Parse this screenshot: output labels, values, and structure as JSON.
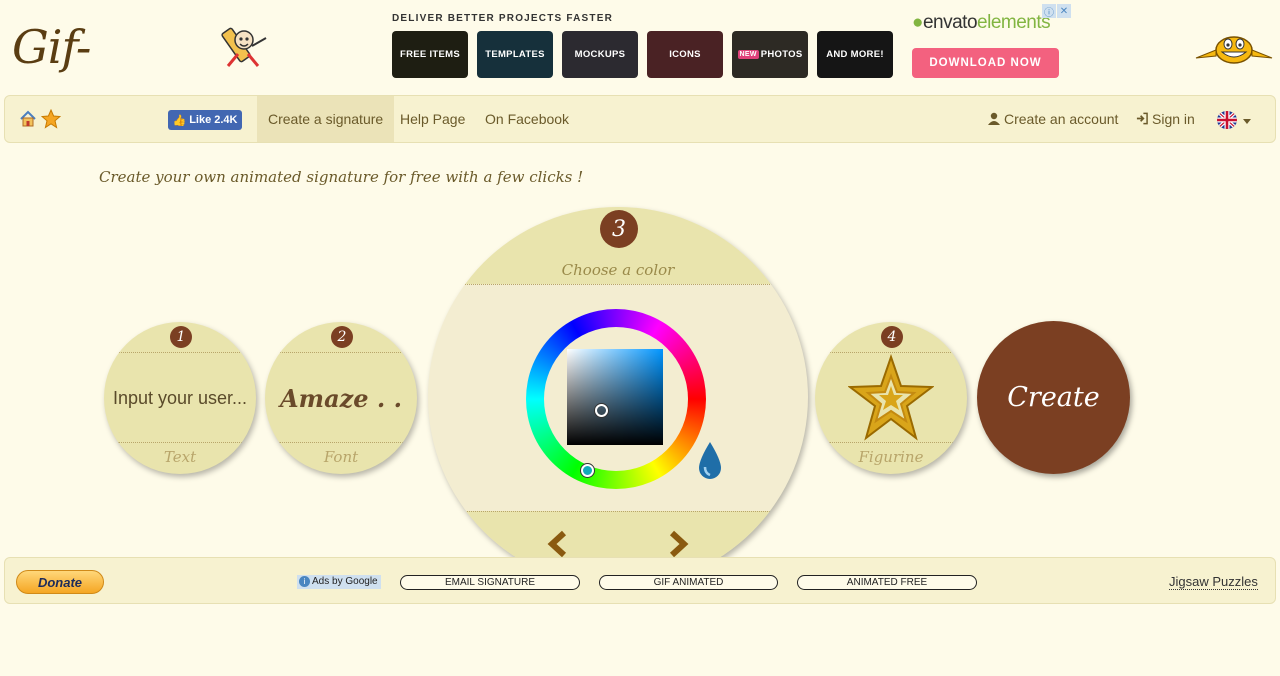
{
  "header": {
    "logo_text": "Gif-mania",
    "ad_title": "DELIVER BETTER PROJECTS FASTER",
    "ad_tiles": [
      {
        "label": "FREE ITEMS",
        "color": "#1e1e12"
      },
      {
        "label": "TEMPLATES",
        "color": "#16303b"
      },
      {
        "label": "MOCKUPS",
        "color": "#2c2a30"
      },
      {
        "label": "ICONS",
        "color": "#4a2224"
      },
      {
        "label": "PHOTOS",
        "badge": "NEW",
        "color": "#2d2a24"
      },
      {
        "label": "AND MORE!",
        "color": "#151515"
      }
    ],
    "envato_prefix": "envato",
    "envato_suffix": "elements",
    "download_label": "DOWNLOAD NOW"
  },
  "nav": {
    "like_label": "Like 2.4K",
    "create_signature": "Create a signature",
    "help_page": "Help Page",
    "on_facebook": "On Facebook",
    "create_account": "Create an account",
    "sign_in": "Sign in"
  },
  "tagline": "Create your own animated signature for free with a few clicks !",
  "steps": {
    "step1": {
      "number": "1",
      "placeholder": "Input your user...",
      "label": "Text"
    },
    "step2": {
      "number": "2",
      "preview": "Amaze . .",
      "label": "Font"
    },
    "step3": {
      "number": "3",
      "label": "Choose a color"
    },
    "step4": {
      "number": "4",
      "label": "Figurine"
    }
  },
  "create_label": "Create",
  "footer": {
    "donate": "Donate",
    "ads_by": "Ads by Google",
    "ad_links": [
      "EMAIL SIGNATURE",
      "GIF ANIMATED",
      "ANIMATED FREE"
    ],
    "jigsaw": "Jigsaw Puzzles"
  },
  "colors": {
    "accent": "#7b3f22",
    "circle": "#e9e4ad",
    "selected_hue": "#0095ff"
  }
}
